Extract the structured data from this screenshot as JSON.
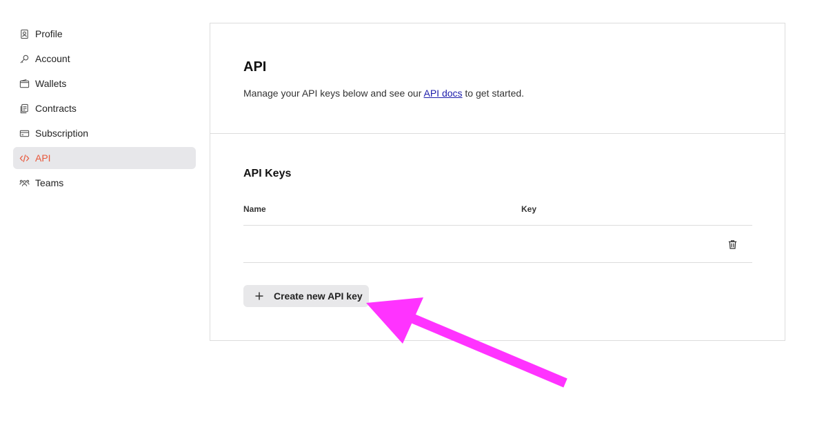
{
  "sidebar": {
    "items": [
      {
        "label": "Profile",
        "icon": "profile-icon"
      },
      {
        "label": "Account",
        "icon": "key-icon"
      },
      {
        "label": "Wallets",
        "icon": "wallet-icon"
      },
      {
        "label": "Contracts",
        "icon": "contracts-icon"
      },
      {
        "label": "Subscription",
        "icon": "card-icon"
      },
      {
        "label": "API",
        "icon": "code-icon",
        "active": true
      },
      {
        "label": "Teams",
        "icon": "teams-icon"
      }
    ]
  },
  "header": {
    "title": "API",
    "description_prefix": "Manage your API keys below and see our ",
    "docs_link": "API docs",
    "description_suffix": " to get started."
  },
  "api_keys": {
    "title": "API Keys",
    "columns": [
      "Name",
      "Key"
    ],
    "rows": [
      {
        "name": "",
        "key": ""
      }
    ],
    "create_button": "Create new API key"
  },
  "colors": {
    "accent": "#e8573a",
    "active_bg": "#e7e7ea",
    "link": "#1c1cab",
    "annotation_arrow": "#ff33ff"
  }
}
